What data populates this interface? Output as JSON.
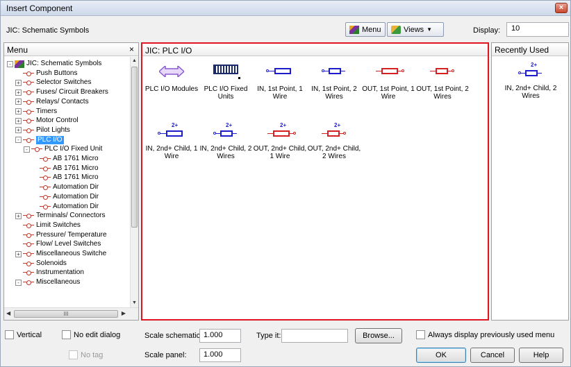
{
  "window": {
    "title": "Insert Component",
    "close_label": "×"
  },
  "header": {
    "library_title": "JIC: Schematic Symbols",
    "menu_button": "Menu",
    "views_button": "Views",
    "display_label": "Display:",
    "display_value": "10"
  },
  "menu_pane": {
    "title": "Menu",
    "close": "×",
    "tree": [
      {
        "label": "JIC: Schematic Symbols",
        "indent": 0,
        "expander": "-",
        "icon": "root"
      },
      {
        "label": "Push Buttons",
        "indent": 1,
        "expander": "",
        "icon": "node"
      },
      {
        "label": "Selector Switches",
        "indent": 1,
        "expander": "+",
        "icon": "node"
      },
      {
        "label": "Fuses/ Circuit Breakers",
        "indent": 1,
        "expander": "+",
        "icon": "node"
      },
      {
        "label": "Relays/ Contacts",
        "indent": 1,
        "expander": "+",
        "icon": "node"
      },
      {
        "label": "Timers",
        "indent": 1,
        "expander": "+",
        "icon": "node"
      },
      {
        "label": "Motor Control",
        "indent": 1,
        "expander": "+",
        "icon": "node"
      },
      {
        "label": "Pilot Lights",
        "indent": 1,
        "expander": "+",
        "icon": "node"
      },
      {
        "label": "PLC I/O",
        "indent": 1,
        "expander": "-",
        "icon": "node",
        "selected": true
      },
      {
        "label": "PLC I/O Fixed Unit",
        "indent": 2,
        "expander": "-",
        "icon": "node"
      },
      {
        "label": "AB 1761 Micro",
        "indent": 3,
        "expander": "",
        "icon": "node"
      },
      {
        "label": "AB 1761 Micro",
        "indent": 3,
        "expander": "",
        "icon": "node"
      },
      {
        "label": "AB 1761 Micro",
        "indent": 3,
        "expander": "",
        "icon": "node"
      },
      {
        "label": "Automation Dir",
        "indent": 3,
        "expander": "",
        "icon": "node"
      },
      {
        "label": "Automation Dir",
        "indent": 3,
        "expander": "",
        "icon": "node"
      },
      {
        "label": "Automation Dir",
        "indent": 3,
        "expander": "",
        "icon": "node"
      },
      {
        "label": "Terminals/ Connectors",
        "indent": 1,
        "expander": "+",
        "icon": "node"
      },
      {
        "label": "Limit Switches",
        "indent": 1,
        "expander": "",
        "icon": "node"
      },
      {
        "label": "Pressure/ Temperature",
        "indent": 1,
        "expander": "",
        "icon": "node"
      },
      {
        "label": "Flow/ Level Switches",
        "indent": 1,
        "expander": "",
        "icon": "node"
      },
      {
        "label": "Miscellaneous Switche",
        "indent": 1,
        "expander": "+",
        "icon": "node"
      },
      {
        "label": "Solenoids",
        "indent": 1,
        "expander": "",
        "icon": "node"
      },
      {
        "label": "Instrumentation",
        "indent": 1,
        "expander": "",
        "icon": "node"
      },
      {
        "label": "Miscellaneous",
        "indent": 1,
        "expander": "-",
        "icon": "node"
      }
    ],
    "hscroll_grip": "III"
  },
  "center_pane": {
    "title": "JIC: PLC I/O",
    "symbols": [
      {
        "label": "PLC I/O Modules",
        "kind": "double-arrow"
      },
      {
        "label": "PLC I/O Fixed Units",
        "kind": "fixed-unit"
      },
      {
        "label": "IN, 1st Point, 1 Wire",
        "kind": "in-1"
      },
      {
        "label": "IN, 1st Point, 2 Wires",
        "kind": "in-2"
      },
      {
        "label": "OUT, 1st Point, 1 Wire",
        "kind": "out-1"
      },
      {
        "label": "OUT, 1st Point, 2 Wires",
        "kind": "out-2"
      },
      {
        "label": "IN, 2nd+ Child, 1 Wire",
        "kind": "in-child-1",
        "badge": "2+"
      },
      {
        "label": "IN, 2nd+ Child, 2 Wires",
        "kind": "in-child-2",
        "badge": "2+"
      },
      {
        "label": "OUT, 2nd+ Child, 1 Wire",
        "kind": "out-child-1",
        "badge": "2+"
      },
      {
        "label": "OUT, 2nd+ Child, 2 Wires",
        "kind": "out-child-2",
        "badge": "2+"
      }
    ]
  },
  "recent_pane": {
    "title": "Recently Used",
    "symbols": [
      {
        "label": "IN, 2nd+ Child, 2 Wires",
        "kind": "in-child-2",
        "badge": "2+"
      }
    ]
  },
  "bottom": {
    "vertical": "Vertical",
    "no_edit_dialog": "No edit dialog",
    "no_tag": "No tag",
    "scale_schematic_label": "Scale schematic:",
    "scale_schematic_value": "1.000",
    "scale_panel_label": "Scale panel:",
    "scale_panel_value": "1.000",
    "type_it_label": "Type it:",
    "type_it_value": "",
    "browse": "Browse...",
    "always_display": "Always display previously used menu",
    "ok": "OK",
    "cancel": "Cancel",
    "help": "Help"
  },
  "colors": {
    "in_blue": "#1d1dcc",
    "out_red": "#d42020",
    "module_purple": "#8a5bd1",
    "selection": "#3399ff",
    "highlight_border": "#e0141e"
  }
}
